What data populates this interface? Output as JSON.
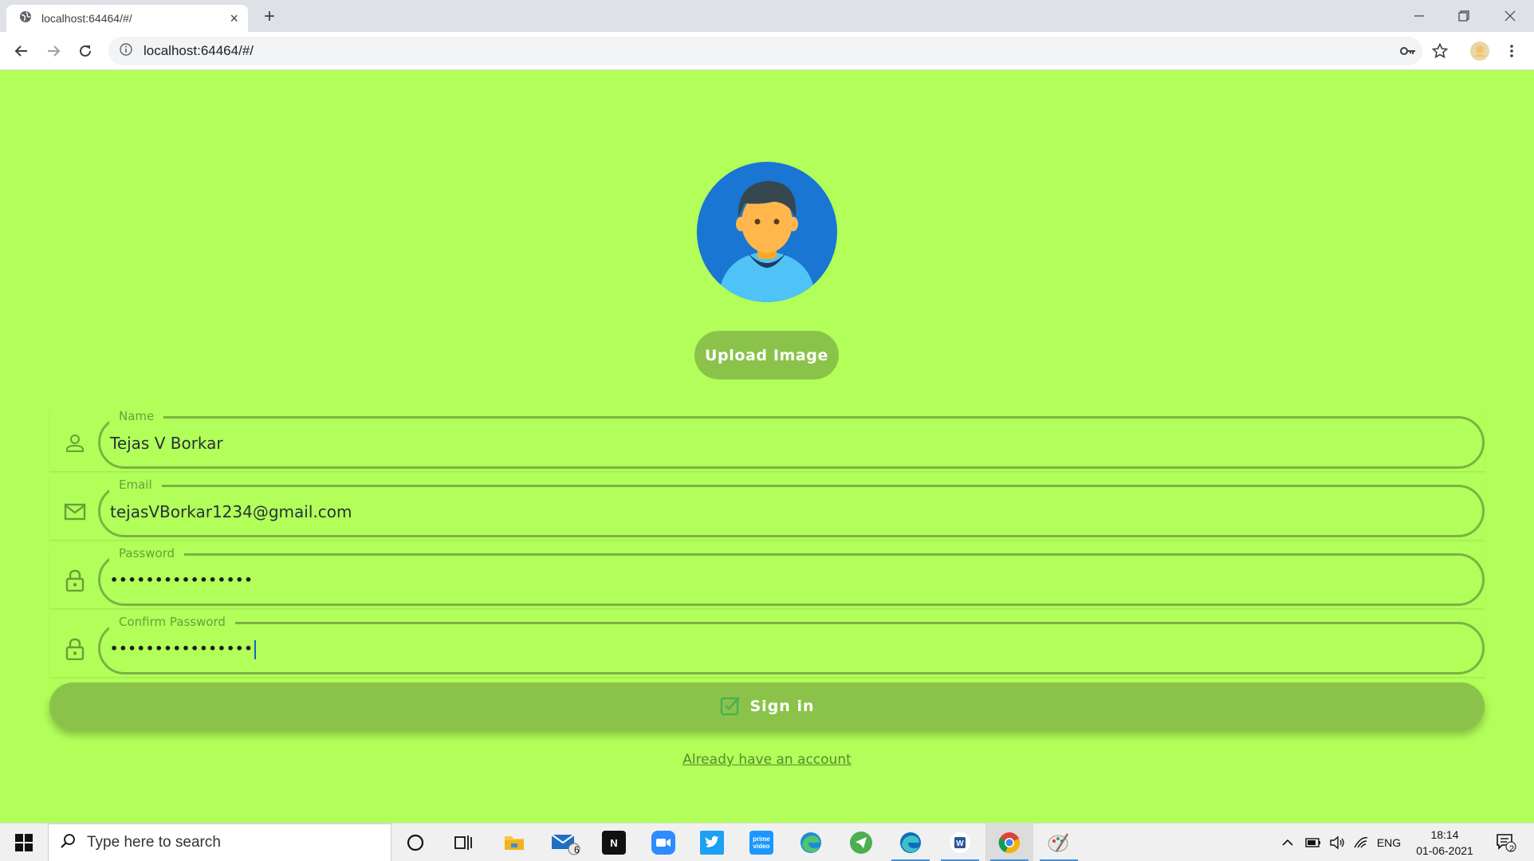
{
  "browser": {
    "tab_title": "localhost:64464/#/",
    "url": "localhost:64464/#/",
    "close_tab_glyph": "×",
    "new_tab_glyph": "+"
  },
  "page": {
    "background": "#b2ff59",
    "accent": "#8bc34a",
    "upload_button": "Upload Image",
    "fields": [
      {
        "label": "Name",
        "value": "Tejas V Borkar",
        "icon": "person-icon"
      },
      {
        "label": "Email",
        "value": "tejasVBorkar1234@gmail.com",
        "icon": "mail-icon"
      },
      {
        "label": "Password",
        "value": "••••••••••••••••",
        "icon": "lock-icon"
      },
      {
        "label": "Confirm Password",
        "value": "••••••••••••••••",
        "icon": "lock-icon"
      }
    ],
    "signin_button": "Sign in",
    "account_link": "Already have an account"
  },
  "taskbar": {
    "search_placeholder": "Type here to search",
    "mail_badge": "6",
    "language": "ENG",
    "time": "18:14",
    "date": "01-06-2021",
    "notifications_badge": "2",
    "apps": [
      "cortana-icon",
      "task-view-icon",
      "file-explorer-icon",
      "mail-icon",
      "notion-icon",
      "zoom-icon",
      "twitter-icon",
      "prime-video-icon",
      "edge-icon",
      "telegram-icon",
      "edge-dev-icon",
      "word-icon",
      "chrome-icon",
      "paint-icon"
    ]
  }
}
